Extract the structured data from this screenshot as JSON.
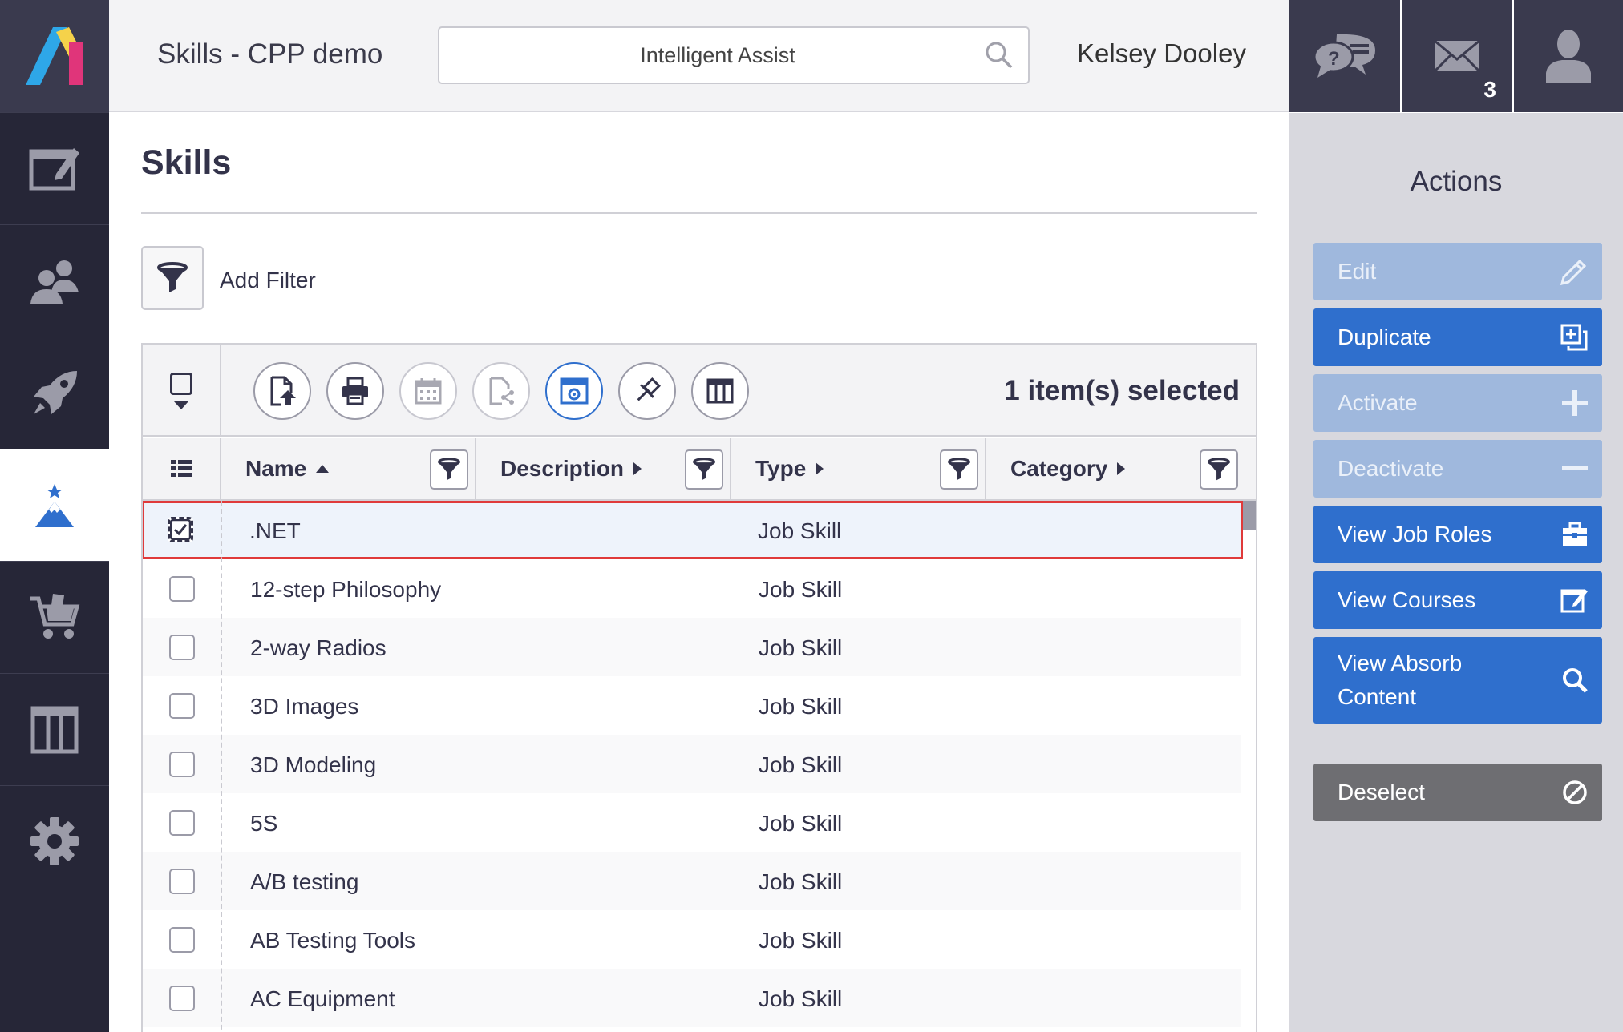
{
  "header": {
    "title": "Skills - CPP demo",
    "search_placeholder": "Intelligent Assist",
    "user_name": "Kelsey Dooley",
    "messages_count": "3"
  },
  "page": {
    "title": "Skills",
    "add_filter_label": "Add Filter",
    "selected_label": "1 item(s) selected"
  },
  "columns": {
    "name": "Name",
    "description": "Description",
    "type": "Type",
    "category": "Category"
  },
  "rows": [
    {
      "name": ".NET",
      "type": "Job Skill",
      "selected": true
    },
    {
      "name": "12-step Philosophy",
      "type": "Job Skill"
    },
    {
      "name": "2-way Radios",
      "type": "Job Skill"
    },
    {
      "name": "3D Images",
      "type": "Job Skill"
    },
    {
      "name": "3D Modeling",
      "type": "Job Skill"
    },
    {
      "name": "5S",
      "type": "Job Skill"
    },
    {
      "name": "A/B testing",
      "type": "Job Skill"
    },
    {
      "name": "AB Testing Tools",
      "type": "Job Skill"
    },
    {
      "name": "AC Equipment",
      "type": "Job Skill"
    }
  ],
  "actions": {
    "title": "Actions",
    "edit": "Edit",
    "duplicate": "Duplicate",
    "activate": "Activate",
    "deactivate": "Deactivate",
    "view_job_roles": "View Job Roles",
    "view_courses": "View Courses",
    "view_absorb_line1": "View Absorb",
    "view_absorb_line2": "Content",
    "deselect": "Deselect"
  },
  "colors": {
    "nav_bg": "#262637",
    "primary_button": "#2f6fcd",
    "disabled_button": "#9fb8dd",
    "selection_outline": "#e03a3a"
  }
}
